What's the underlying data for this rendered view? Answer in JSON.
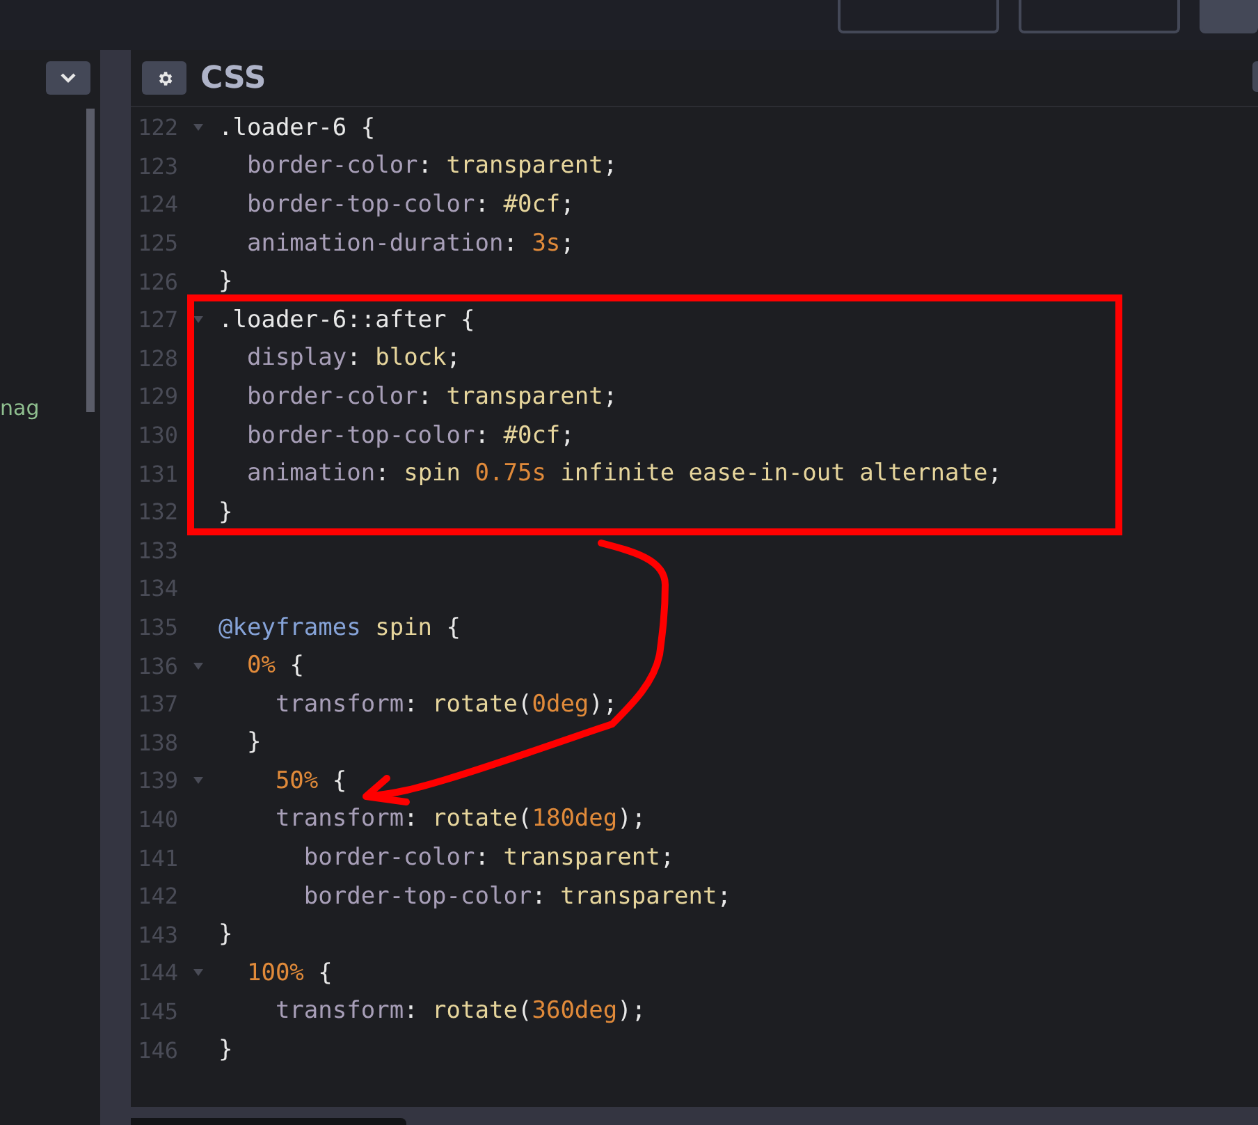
{
  "left_panel": {
    "text": "nag"
  },
  "editor": {
    "title": "CSS",
    "lines": [
      {
        "number": "122",
        "fold": true,
        "tokens": [
          {
            "kind": "selector",
            "text": ".loader-6 "
          },
          {
            "kind": "punct",
            "text": "{"
          }
        ]
      },
      {
        "number": "123",
        "fold": false,
        "tokens": [
          {
            "kind": "property",
            "text": "  border-color"
          },
          {
            "kind": "punct",
            "text": ": "
          },
          {
            "kind": "value",
            "text": "transparent"
          },
          {
            "kind": "punct",
            "text": ";"
          }
        ]
      },
      {
        "number": "124",
        "fold": false,
        "tokens": [
          {
            "kind": "property",
            "text": "  border-top-color"
          },
          {
            "kind": "punct",
            "text": ": "
          },
          {
            "kind": "value",
            "text": "#0cf"
          },
          {
            "kind": "punct",
            "text": ";"
          }
        ]
      },
      {
        "number": "125",
        "fold": false,
        "tokens": [
          {
            "kind": "property",
            "text": "  animation-duration"
          },
          {
            "kind": "punct",
            "text": ": "
          },
          {
            "kind": "number",
            "text": "3s"
          },
          {
            "kind": "punct",
            "text": ";"
          }
        ]
      },
      {
        "number": "126",
        "fold": false,
        "tokens": [
          {
            "kind": "punct",
            "text": "}"
          }
        ]
      },
      {
        "number": "127",
        "fold": true,
        "tokens": [
          {
            "kind": "selector",
            "text": ".loader-6::after "
          },
          {
            "kind": "punct",
            "text": "{"
          }
        ]
      },
      {
        "number": "128",
        "fold": false,
        "tokens": [
          {
            "kind": "property",
            "text": "  display"
          },
          {
            "kind": "punct",
            "text": ": "
          },
          {
            "kind": "value",
            "text": "block"
          },
          {
            "kind": "punct",
            "text": ";"
          }
        ]
      },
      {
        "number": "129",
        "fold": false,
        "tokens": [
          {
            "kind": "property",
            "text": "  border-color"
          },
          {
            "kind": "punct",
            "text": ": "
          },
          {
            "kind": "value",
            "text": "transparent"
          },
          {
            "kind": "punct",
            "text": ";"
          }
        ]
      },
      {
        "number": "130",
        "fold": false,
        "tokens": [
          {
            "kind": "property",
            "text": "  border-top-color"
          },
          {
            "kind": "punct",
            "text": ": "
          },
          {
            "kind": "value",
            "text": "#0cf"
          },
          {
            "kind": "punct",
            "text": ";"
          }
        ]
      },
      {
        "number": "131",
        "fold": false,
        "tokens": [
          {
            "kind": "property",
            "text": "  animation"
          },
          {
            "kind": "punct",
            "text": ": "
          },
          {
            "kind": "value",
            "text": "spin "
          },
          {
            "kind": "number",
            "text": "0.75s"
          },
          {
            "kind": "value",
            "text": " infinite ease-in-out alternate"
          },
          {
            "kind": "punct",
            "text": ";"
          }
        ]
      },
      {
        "number": "132",
        "fold": false,
        "tokens": [
          {
            "kind": "punct",
            "text": "}"
          }
        ]
      },
      {
        "number": "133",
        "fold": false
      },
      {
        "number": "134",
        "fold": false
      },
      {
        "number": "135",
        "fold": false,
        "tokens": [
          {
            "kind": "atrule",
            "text": "@keyframes "
          },
          {
            "kind": "value",
            "text": "spin "
          },
          {
            "kind": "punct",
            "text": "{"
          }
        ]
      },
      {
        "number": "136",
        "fold": true,
        "tokens": [
          {
            "kind": "number",
            "text": "  0%"
          },
          {
            "kind": "punct",
            "text": " {"
          }
        ]
      },
      {
        "number": "137",
        "fold": false,
        "tokens": [
          {
            "kind": "property",
            "text": "    transform"
          },
          {
            "kind": "punct",
            "text": ": "
          },
          {
            "kind": "value",
            "text": "rotate"
          },
          {
            "kind": "punct",
            "text": "("
          },
          {
            "kind": "number",
            "text": "0deg"
          },
          {
            "kind": "punct",
            "text": ");"
          }
        ]
      },
      {
        "number": "138",
        "fold": false,
        "tokens": [
          {
            "kind": "punct",
            "text": "  }"
          }
        ]
      },
      {
        "number": "139",
        "fold": true,
        "tokens": [
          {
            "kind": "number",
            "text": "    50%"
          },
          {
            "kind": "punct",
            "text": " {"
          }
        ]
      },
      {
        "number": "140",
        "fold": false,
        "tokens": [
          {
            "kind": "property",
            "text": "    transform"
          },
          {
            "kind": "punct",
            "text": ": "
          },
          {
            "kind": "value",
            "text": "rotate"
          },
          {
            "kind": "punct",
            "text": "("
          },
          {
            "kind": "number",
            "text": "180deg"
          },
          {
            "kind": "punct",
            "text": ");"
          }
        ]
      },
      {
        "number": "141",
        "fold": false,
        "tokens": [
          {
            "kind": "property",
            "text": "      border-color"
          },
          {
            "kind": "punct",
            "text": ": "
          },
          {
            "kind": "value",
            "text": "transparent"
          },
          {
            "kind": "punct",
            "text": ";"
          }
        ]
      },
      {
        "number": "142",
        "fold": false,
        "tokens": [
          {
            "kind": "property",
            "text": "      border-top-color"
          },
          {
            "kind": "punct",
            "text": ": "
          },
          {
            "kind": "value",
            "text": "transparent"
          },
          {
            "kind": "punct",
            "text": ";"
          }
        ]
      },
      {
        "number": "143",
        "fold": false,
        "tokens": [
          {
            "kind": "punct",
            "text": "}"
          }
        ]
      },
      {
        "number": "144",
        "fold": true,
        "tokens": [
          {
            "kind": "number",
            "text": "  100%"
          },
          {
            "kind": "punct",
            "text": " {"
          }
        ]
      },
      {
        "number": "145",
        "fold": false,
        "tokens": [
          {
            "kind": "property",
            "text": "    transform"
          },
          {
            "kind": "punct",
            "text": ": "
          },
          {
            "kind": "value",
            "text": "rotate"
          },
          {
            "kind": "punct",
            "text": "("
          },
          {
            "kind": "number",
            "text": "360deg"
          },
          {
            "kind": "punct",
            "text": ");"
          }
        ]
      },
      {
        "number": "146",
        "fold": false,
        "tokens": [
          {
            "kind": "punct",
            "text": "}"
          }
        ]
      }
    ]
  }
}
